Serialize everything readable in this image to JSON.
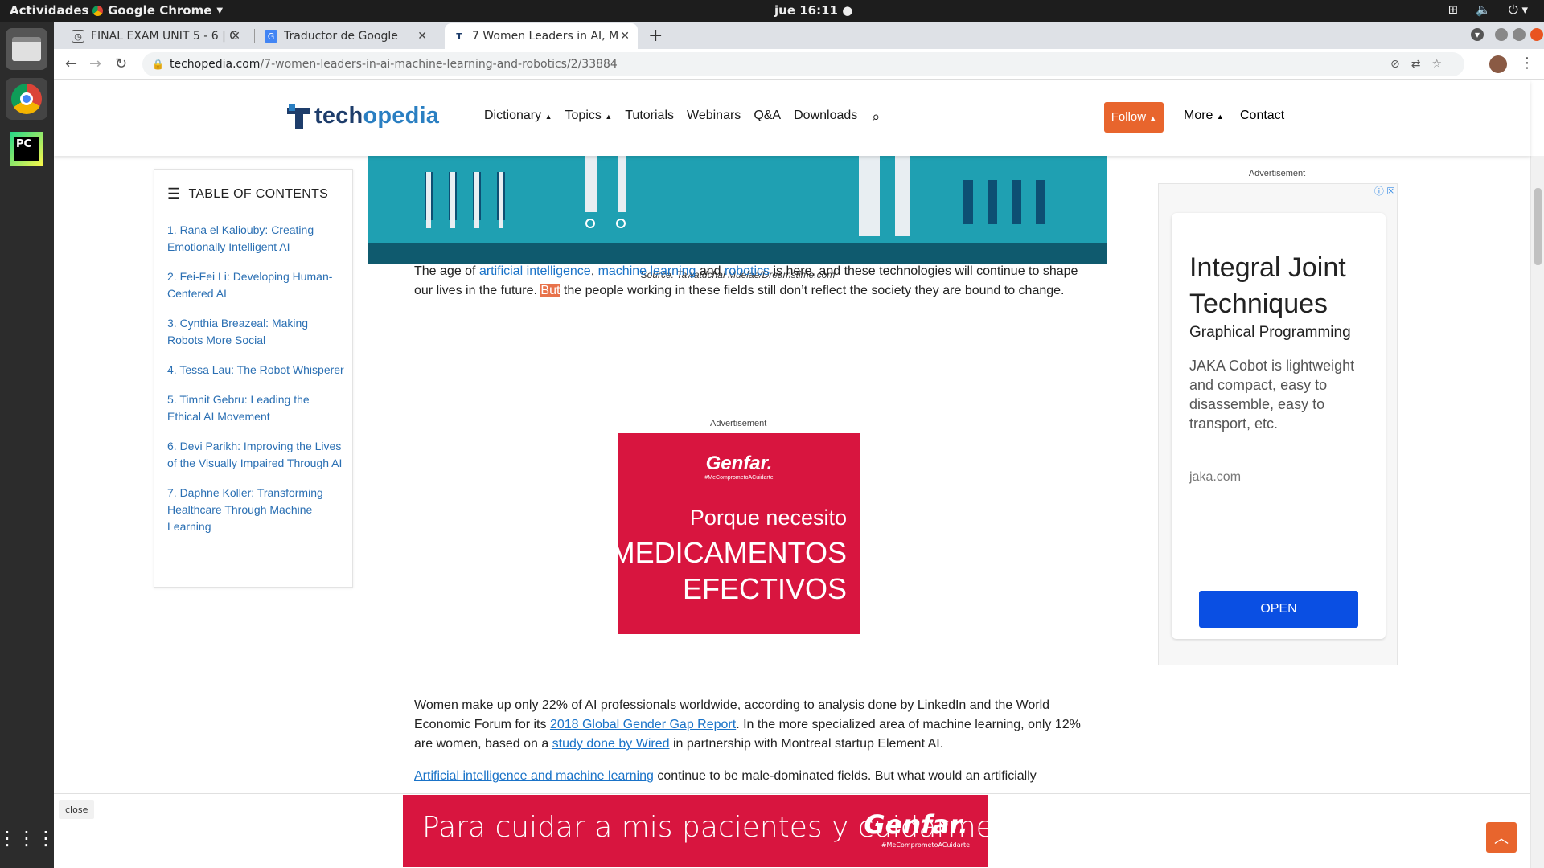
{
  "system": {
    "activities": "Actividades",
    "app_name": "Google Chrome",
    "clock": "jue 16:11"
  },
  "browser": {
    "tabs": [
      {
        "title": "FINAL EXAM UNIT 5 - 6 | C",
        "active": false
      },
      {
        "title": "Traductor de Google",
        "active": false
      },
      {
        "title": "7 Women Leaders in AI, M",
        "active": true
      }
    ],
    "url_host": "techopedia.com",
    "url_path": "/7-women-leaders-in-ai-machine-learning-and-robotics/2/33884"
  },
  "site": {
    "logo_part1": "tech",
    "logo_part2": "opedia",
    "nav": [
      "Dictionary",
      "Topics",
      "Tutorials",
      "Webinars",
      "Q&A",
      "Downloads"
    ],
    "follow_label": "Follow",
    "more_label": "More",
    "contact_label": "Contact"
  },
  "toc": {
    "heading": "TABLE OF CONTENTS",
    "items": [
      "1. Rana el Kaliouby: Creating Emotionally Intelligent AI",
      "2. Fei-Fei Li: Developing Human-Centered AI",
      "3. Cynthia Breazeal: Making Robots More Social",
      "4. Tessa Lau: The Robot Whisperer",
      "5. Timnit Gebru: Leading the Ethical AI Movement",
      "6. Devi Parikh: Improving the Lives of the Visually Impaired Through AI",
      "7. Daphne Koller: Transforming Healthcare Through Machine Learning"
    ]
  },
  "article": {
    "caption": "Source: Tawatdchai Muelae/Dreamstime.com",
    "p1": {
      "t1": "The age of ",
      "link1": "artificial intelligence",
      "t2": ", ",
      "link2": "machine learning",
      "t3": " and ",
      "link3": "robotics",
      "t4": " is here, and these technologies will continue to shape our lives in the future. ",
      "highlight": "But",
      "t5": " the people working in these fields still don’t reflect the society they are bound to change."
    },
    "p2": {
      "t1": "Women make up only 22% of AI professionals worldwide, according to analysis done by LinkedIn and the World Economic Forum for its ",
      "link1": "2018 Global Gender Gap Report",
      "t2": ". In the more specialized area of machine learning, only 12% are women, based on a ",
      "link2": "study done by Wired",
      "t3": " in partnership with Montreal startup Element AI."
    },
    "p3": {
      "link1": "Artificial intelligence and machine learning",
      "t1": " continue to be male-dominated fields. But what would an artificially"
    }
  },
  "ads": {
    "label": "Advertisement",
    "genfar_brand": "Genfar.",
    "genfar_tag": "#MeComprometoACuidarte",
    "genfar_line1": "Porque necesito",
    "genfar_line2": "MEDICAMENTOS",
    "genfar_line3": "EFECTIVOS",
    "side_title": "Integral Joint Techniques",
    "side_subtitle": "Graphical Programming",
    "side_body": "JAKA Cobot is lightweight and compact, easy to disassemble, easy to transport, etc.",
    "side_domain": "jaka.com",
    "side_button": "OPEN",
    "bottom_text": "Para cuidar a mis pacientes y cuidarme a mí,",
    "close_label": "close"
  },
  "colors": {
    "accent_orange": "#e8652d",
    "genfar_red": "#d8153f",
    "link_blue": "#1a73c8",
    "ad_button_blue": "#0a4fe3"
  }
}
